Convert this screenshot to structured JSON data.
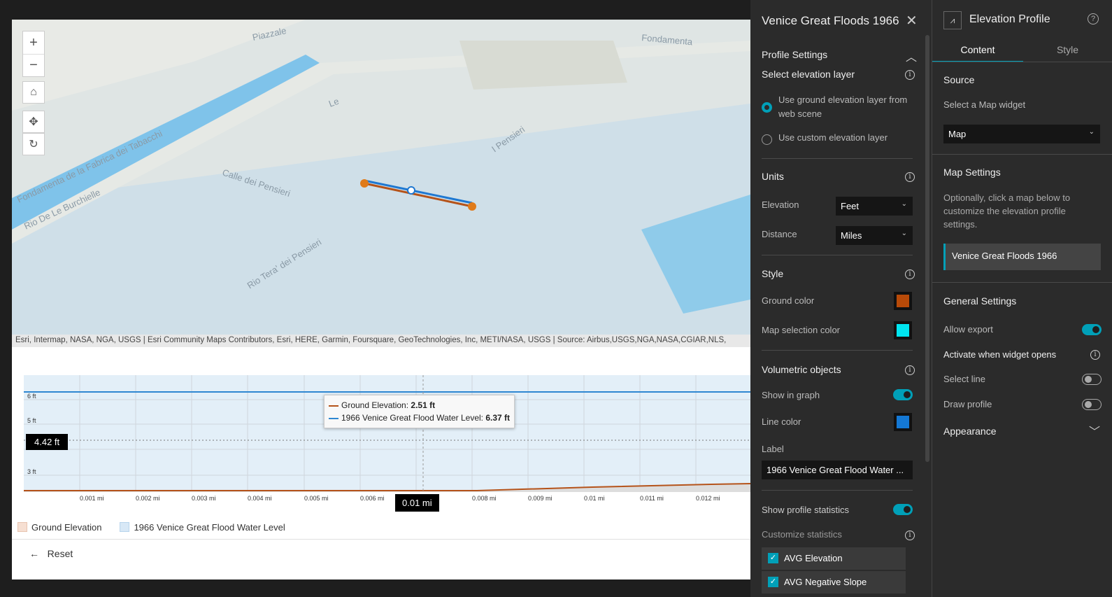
{
  "map": {
    "attribution": "Esri, Intermap, NASA, NGA, USGS | Esri Community Maps Contributors, Esri, HERE, Garmin, Foursquare, GeoTechnologies, Inc, METI/NASA, USGS | Source: Airbus,USGS,NGA,NASA,CGIAR,NLS,",
    "labels": [
      "Piazzale",
      "Fondamenta",
      "Rio De Le Burchielle",
      "Fondamenta de la Fabrica dei Tabacchi",
      "Calle dei Pensieri",
      "Rio Tera' dei Pensieri",
      "I Pensieri",
      "Le"
    ]
  },
  "chart_data": {
    "type": "line",
    "y_ticks": [
      "6 ft",
      "5 ft",
      "3 ft"
    ],
    "x_ticks": [
      "0.001 mi",
      "0.002 mi",
      "0.003 mi",
      "0.004 mi",
      "0.005 mi",
      "0.006 mi",
      "0.008 mi",
      "0.009 mi",
      "0.01 mi",
      "0.011 mi",
      "0.012 mi"
    ],
    "series": [
      {
        "name": "Ground Elevation",
        "color": "#b5531a"
      },
      {
        "name": "1966 Venice Great Flood Water Level",
        "color": "#2f87d1"
      }
    ],
    "tooltip": {
      "ground_label": "Ground Elevation:",
      "ground_value": "2.51 ft",
      "water_label": "1966 Venice Great Flood Water Level:",
      "water_value": "6.37 ft"
    },
    "cursor_y": "4.42 ft",
    "cursor_x": "0.01 mi"
  },
  "profile": {
    "legend": [
      "Ground Elevation",
      "1966 Venice Great Flood Water Level"
    ],
    "reset": "Reset"
  },
  "settings": {
    "title": "Venice Great Floods 1966",
    "profile_settings": "Profile Settings",
    "select_layer": "Select elevation layer",
    "radio1": "Use ground elevation layer from web scene",
    "radio2": "Use custom elevation layer",
    "units": "Units",
    "elevation": "Elevation",
    "elevation_value": "Feet",
    "distance": "Distance",
    "distance_value": "Miles",
    "style": "Style",
    "ground_color": "Ground color",
    "map_sel_color": "Map selection color",
    "volumetric": "Volumetric objects",
    "show_graph": "Show in graph",
    "line_color": "Line color",
    "label": "Label",
    "label_value": "1966 Venice Great Flood Water ...",
    "show_stats": "Show profile statistics",
    "customize_stats": "Customize statistics",
    "stats": [
      "AVG Elevation",
      "AVG Negative Slope"
    ],
    "colors": {
      "ground": "#b84a08",
      "selection": "#00e5f0",
      "line": "#1478d4"
    }
  },
  "widget": {
    "title": "Elevation Profile",
    "tabs": [
      "Content",
      "Style"
    ],
    "source": "Source",
    "select_map": "Select a Map widget",
    "map_value": "Map",
    "map_settings": "Map Settings",
    "map_desc": "Optionally, click a map below to customize the elevation profile settings.",
    "map_item": "Venice Great Floods 1966",
    "general": "General Settings",
    "allow_export": "Allow export",
    "activate": "Activate when widget opens",
    "select_line": "Select line",
    "draw_profile": "Draw profile",
    "appearance": "Appearance"
  }
}
